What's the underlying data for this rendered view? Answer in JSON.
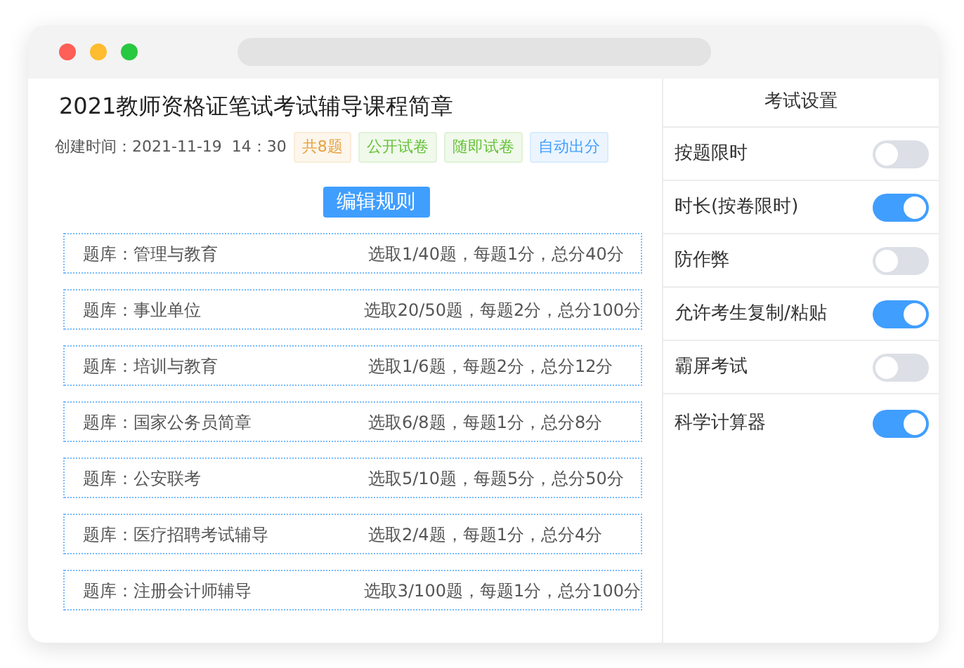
{
  "title": "2021教师资格证笔试考试辅导课程简章",
  "created": "创建时间：2021-11-19  14：30",
  "tags": [
    {
      "label": "共8题",
      "kind": "count"
    },
    {
      "label": "公开试卷",
      "kind": "mode"
    },
    {
      "label": "随即试卷",
      "kind": "mode"
    },
    {
      "label": "自动出分",
      "kind": "scoring"
    }
  ],
  "edit_button": "编辑规则",
  "banks": [
    {
      "name": "题库：管理与教育",
      "rule": "选取1/40题，每题1分，总分40分"
    },
    {
      "name": "题库：事业单位",
      "rule": "选取20/50题，每题2分，总分100分"
    },
    {
      "name": "题库：培训与教育",
      "rule": "选取1/6题，每题2分，总分12分"
    },
    {
      "name": "题库：国家公务员简章",
      "rule": "选取6/8题，每题1分，总分8分"
    },
    {
      "name": "题库：公安联考",
      "rule": "选取5/10题，每题5分，总分50分"
    },
    {
      "name": "题库：医疗招聘考试辅导",
      "rule": "选取2/4题，每题1分，总分4分"
    },
    {
      "name": "题库：注册会计师辅导",
      "rule": "选取3/100题，每题1分，总分100分"
    }
  ],
  "settings": {
    "title": "考试设置",
    "items": [
      {
        "label": "按题限时",
        "on": false
      },
      {
        "label": "时长(按卷限时)",
        "on": true
      },
      {
        "label": "防作弊",
        "on": false
      },
      {
        "label": "允许考生复制/粘贴",
        "on": true
      },
      {
        "label": "霸屏考试",
        "on": false
      },
      {
        "label": "科学计算器",
        "on": true
      }
    ]
  }
}
